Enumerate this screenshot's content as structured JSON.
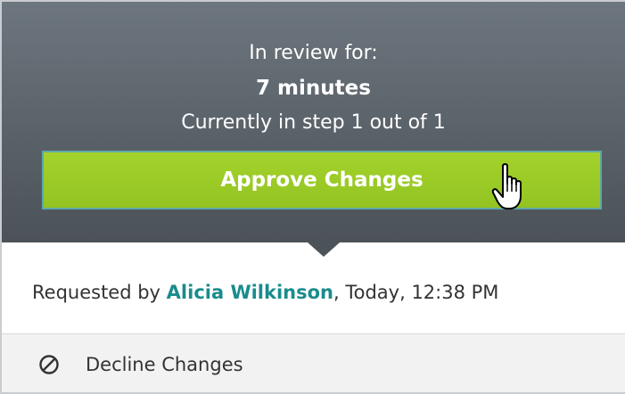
{
  "review": {
    "label": "In review for:",
    "duration": "7 minutes",
    "step_text": "Currently in step 1 out of 1",
    "approve_label": "Approve Changes"
  },
  "request": {
    "prefix": "Requested by ",
    "requester": "Alicia Wilkinson",
    "suffix": ", Today, 12:38 PM"
  },
  "decline": {
    "label": "Decline Changes",
    "icon": "prohibited-icon"
  },
  "colors": {
    "approve_green": "#9ccb27",
    "panel_gray": "#5a6269",
    "link_teal": "#1a8c8c"
  }
}
